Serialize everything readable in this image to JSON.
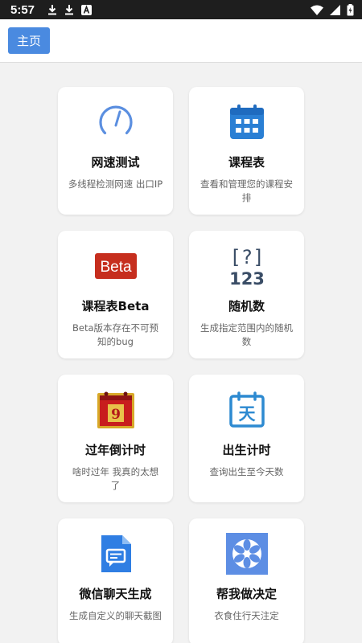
{
  "status_bar": {
    "time": "5:57",
    "icons": [
      "download-icon",
      "download-icon",
      "app-a-icon",
      "wifi-icon",
      "signal-icon",
      "battery-icon"
    ]
  },
  "header": {
    "home_label": "主页"
  },
  "colors": {
    "accent": "#4a8ae0",
    "background": "#f2f2f2",
    "card": "#ffffff",
    "title": "#111111",
    "desc": "#666666"
  },
  "cards": [
    {
      "title": "网速测试",
      "desc": "多线程检测网速 出口IP",
      "icon": "speedometer-icon"
    },
    {
      "title": "课程表",
      "desc": "查看和管理您的课程安排",
      "icon": "calendar-icon"
    },
    {
      "title": "课程表Beta",
      "desc": "Beta版本存在不可预知的bug",
      "icon": "beta-badge-icon",
      "badge": "Beta"
    },
    {
      "title": "随机数",
      "desc": "生成指定范围内的随机数",
      "icon": "random-number-icon",
      "glyph_top": "[?]",
      "glyph_bottom": "123"
    },
    {
      "title": "过年倒计时",
      "desc": "啥时过年 我真的太想了",
      "icon": "new-year-calendar-icon",
      "glyph": "9"
    },
    {
      "title": "出生计时",
      "desc": "查询出生至今天数",
      "icon": "day-calendar-icon",
      "glyph": "天"
    },
    {
      "title": "微信聊天生成",
      "desc": "生成自定义的聊天截图",
      "icon": "chat-document-icon"
    },
    {
      "title": "帮我做决定",
      "desc": "衣食住行天注定",
      "icon": "decision-wheel-icon"
    }
  ]
}
